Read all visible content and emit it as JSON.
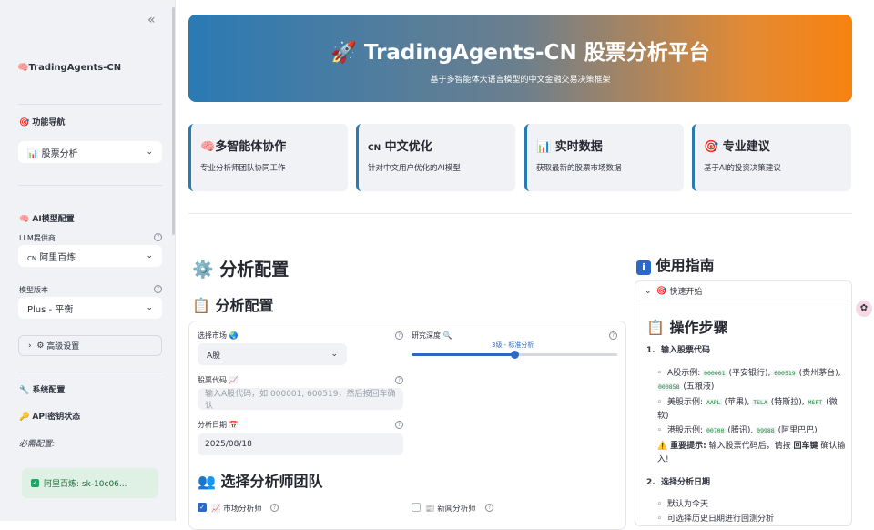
{
  "sidebar": {
    "collapse_icon": "«",
    "app_title": "TradingAgents-CN",
    "nav_header": "功能导航",
    "nav_select": "股票分析",
    "ai_header": "AI模型配置",
    "llm_label": "LLM提供商",
    "llm_value": "阿里百炼",
    "model_label": "模型版本",
    "model_value": "Plus - 平衡",
    "advanced": "高级设置",
    "sys_header": "系统配置",
    "api_header": "API密钥状态",
    "required": "必需配置:",
    "api_ok": "阿里百炼: sk-10c06..."
  },
  "banner": {
    "title": "TradingAgents-CN 股票分析平台",
    "subtitle": "基于多智能体大语言模型的中文金融交易决策框架"
  },
  "cards": [
    {
      "title": "多智能体协作",
      "desc": "专业分析师团队协同工作"
    },
    {
      "title": "中文优化",
      "desc": "针对中文用户优化的AI模型"
    },
    {
      "title": "实时数据",
      "desc": "获取最新的股票市场数据"
    },
    {
      "title": "专业建议",
      "desc": "基于AI的投资决策建议"
    }
  ],
  "analysis": {
    "header": "分析配置",
    "subheader": "分析配置",
    "market_label": "选择市场",
    "market_value": "A股",
    "depth_label": "研究深度",
    "depth_value": "3级 - 标准分析",
    "depth_fraction": 0.5,
    "code_label": "股票代码",
    "code_placeholder": "输入A股代码，如 000001, 600519，然后按回车确认",
    "date_label": "分析日期",
    "date_value": "2025/08/18",
    "team_header": "选择分析师团队",
    "analysts": [
      {
        "label": "市场分析师",
        "checked": true
      },
      {
        "label": "新闻分析师",
        "checked": false
      }
    ]
  },
  "guide": {
    "header": "使用指南",
    "expander": "快速开始",
    "steps_title": "操作步骤",
    "step1": "输入股票代码",
    "a_share_prefix": "A股示例: ",
    "a_codes": [
      "000001",
      "600519",
      "000858"
    ],
    "a_names": [
      "(平安银行),",
      "(贵州茅台),",
      "(五粮液)"
    ],
    "us_prefix": "美股示例: ",
    "us_codes": [
      "AAPL",
      "TSLA",
      "MSFT"
    ],
    "us_names": [
      "(苹果),",
      "(特斯拉),",
      "(微软)"
    ],
    "hk_prefix": "港股示例: ",
    "hk_codes": [
      "00700",
      "09988"
    ],
    "hk_names": [
      "(腾讯),",
      "(阿里巴巴)"
    ],
    "tip_bold": "重要提示:",
    "tip_text": "输入股票代码后，请按",
    "tip_key": "回车键",
    "tip_tail": "确认输入!",
    "step2": "选择分析日期",
    "date_item1": "默认为今天",
    "date_item2": "可选择历史日期进行回测分析"
  },
  "colors": {
    "accent": "#2c68c5",
    "gradient_start": "#2a7ab4",
    "gradient_end": "#f7820f"
  }
}
